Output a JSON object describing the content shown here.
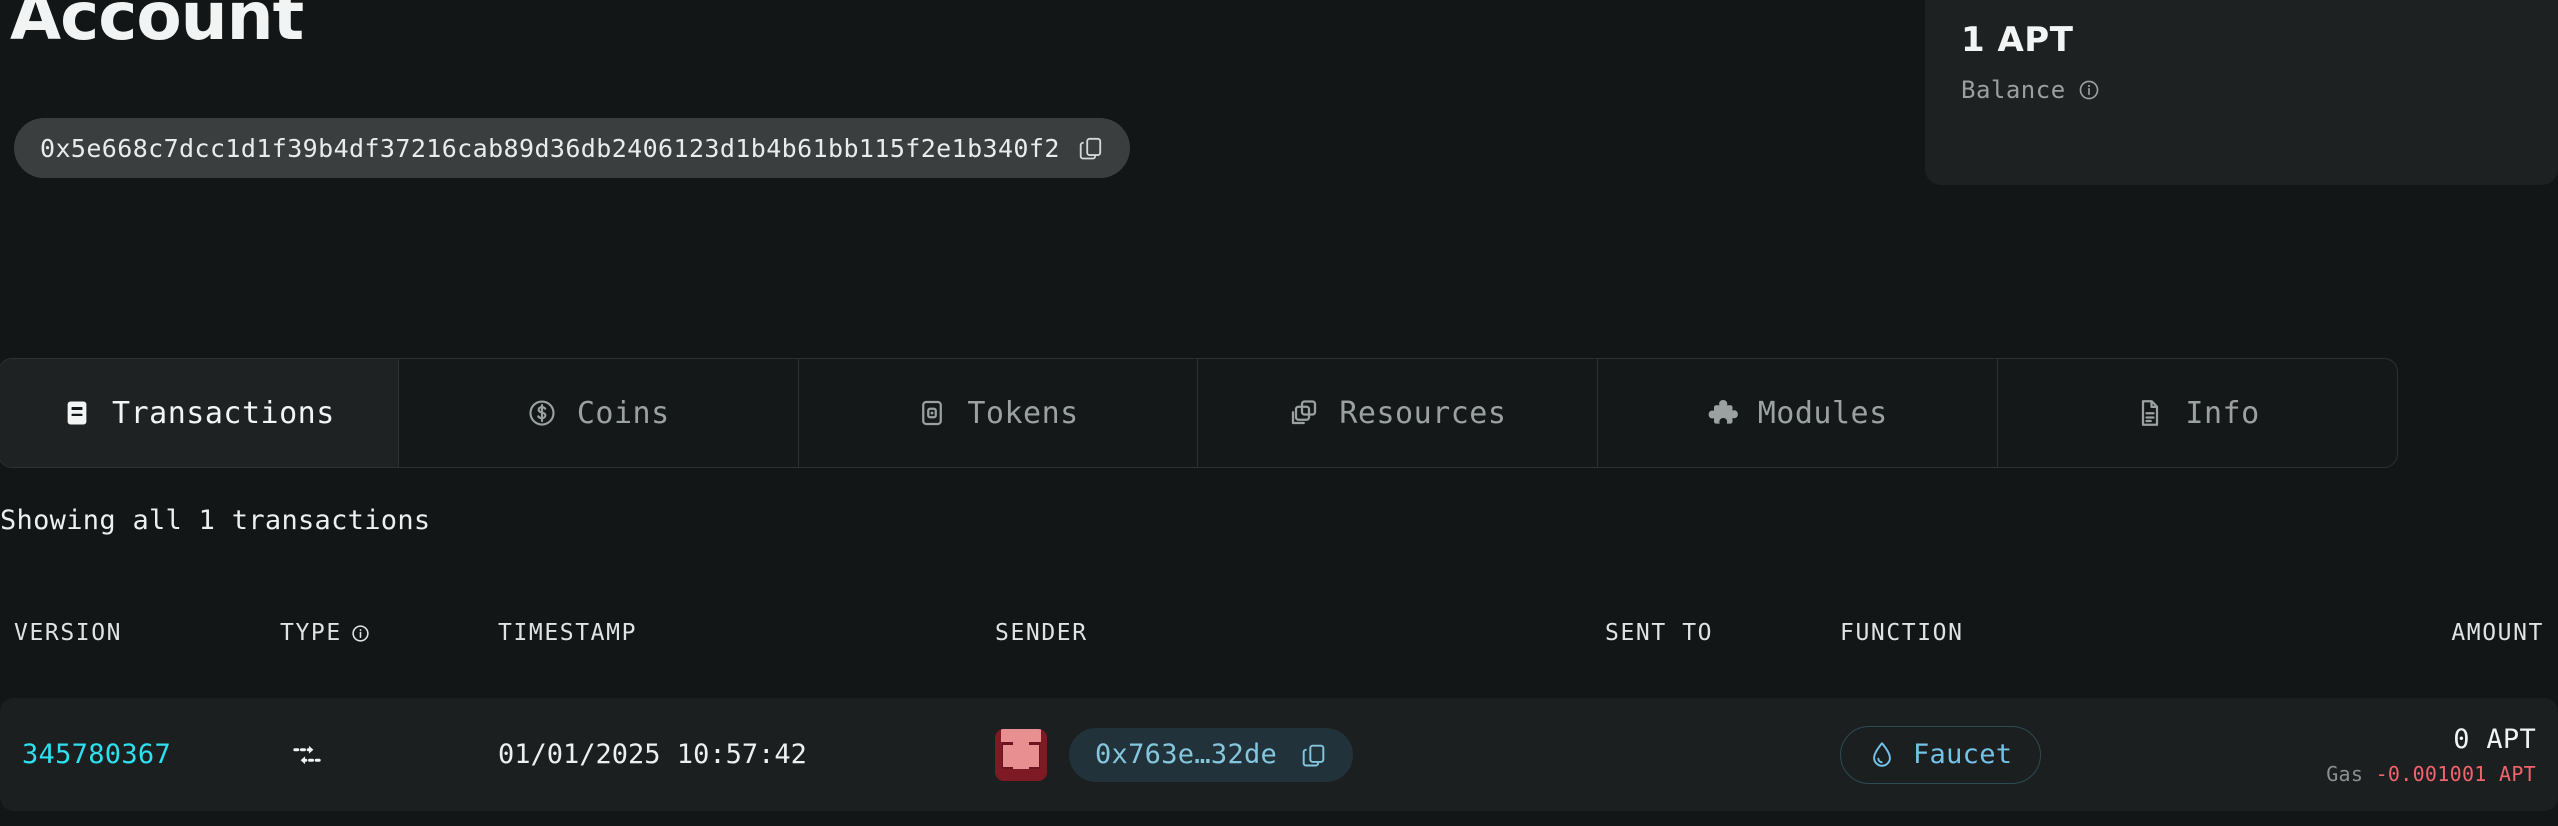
{
  "header": {
    "title": "Account",
    "address": "0x5e668c7dcc1d1f39b4df37216cab89d36db2406123d1b4b61bb115f2e1b340f2",
    "copy_icon": "copy-icon"
  },
  "balance_card": {
    "value": "1 APT",
    "label": "Balance",
    "info_icon": "info-icon"
  },
  "tabs": [
    {
      "label": "Transactions",
      "icon": "receipt-icon",
      "active": true
    },
    {
      "label": "Coins",
      "icon": "coin-icon",
      "active": false
    },
    {
      "label": "Tokens",
      "icon": "token-icon",
      "active": false
    },
    {
      "label": "Resources",
      "icon": "layers-icon",
      "active": false
    },
    {
      "label": "Modules",
      "icon": "puzzle-icon",
      "active": false
    },
    {
      "label": "Info",
      "icon": "document-icon",
      "active": false
    }
  ],
  "table": {
    "showing_text": "Showing all 1 transactions",
    "columns": [
      {
        "key": "version",
        "label": "VERSION",
        "info": false
      },
      {
        "key": "type",
        "label": "TYPE",
        "info": true
      },
      {
        "key": "timestamp",
        "label": "TIMESTAMP",
        "info": false
      },
      {
        "key": "sender",
        "label": "SENDER",
        "info": false
      },
      {
        "key": "sent_to",
        "label": "SENT TO",
        "info": false
      },
      {
        "key": "function",
        "label": "FUNCTION",
        "info": false
      },
      {
        "key": "amount",
        "label": "AMOUNT",
        "info": false
      }
    ],
    "rows": [
      {
        "version": "345780367",
        "type_icon": "transaction-arrows-icon",
        "timestamp": "01/01/2025 10:57:42",
        "sender_avatar": "identicon-avatar",
        "sender_address": "0x763e…32de",
        "sent_to": "",
        "function_label": "Faucet",
        "function_icon": "droplet-icon",
        "amount": "0 APT",
        "gas_label": "Gas",
        "gas_value": "-0.001001 APT"
      }
    ]
  },
  "colors": {
    "page_background": "#121616",
    "card_background": "#1d2121",
    "row_background": "#1b1f1f",
    "accent_cyan": "#2ee0ef",
    "chip_blue": "#84c6dd",
    "function_blue": "#73c3e8",
    "gas_red": "#f2636e",
    "avatar_red": "#6d1420"
  }
}
